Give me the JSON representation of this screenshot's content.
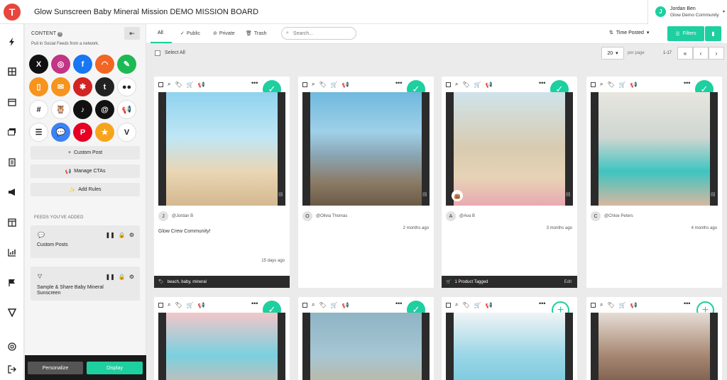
{
  "app": {
    "logo_letter": "T",
    "board_title": "Glow Sunscreen Baby Mineral Mission DEMO MISSION BOARD"
  },
  "user": {
    "initial": "J",
    "name": "Jordan Ben",
    "org": "Glow Demo Community"
  },
  "panel": {
    "heading": "CONTENT",
    "subheading": "Pull in Social Feeds from a network.",
    "networks": [
      {
        "name": "x",
        "glyph": "X",
        "color": "#111111"
      },
      {
        "name": "instagram",
        "glyph": "◎",
        "color": "#c13584"
      },
      {
        "name": "facebook",
        "glyph": "f",
        "color": "#1877f2"
      },
      {
        "name": "rss",
        "glyph": "◠",
        "color": "#f26522"
      },
      {
        "name": "custom-edit",
        "glyph": "✎",
        "color": "#1db954"
      },
      {
        "name": "mobile",
        "glyph": "▯",
        "color": "#f7941d"
      },
      {
        "name": "email",
        "glyph": "✉",
        "color": "#f7941d"
      },
      {
        "name": "yelp",
        "glyph": "✱",
        "color": "#d32323"
      },
      {
        "name": "tumblr",
        "glyph": "t",
        "color": "#222222"
      },
      {
        "name": "flickr",
        "glyph": "●●",
        "color": "#ffffff"
      },
      {
        "name": "slack",
        "glyph": "#",
        "color": "#ffffff"
      },
      {
        "name": "hootsuite",
        "glyph": "🦉",
        "color": "#ffffff"
      },
      {
        "name": "tiktok",
        "glyph": "♪",
        "color": "#111111"
      },
      {
        "name": "threads",
        "glyph": "@",
        "color": "#111111"
      },
      {
        "name": "megaphone",
        "glyph": "📢",
        "color": "#ffffff"
      },
      {
        "name": "list",
        "glyph": "☰",
        "color": "#ffffff"
      },
      {
        "name": "chat",
        "glyph": "💬",
        "color": "#3b82f6"
      },
      {
        "name": "pinterest",
        "glyph": "P",
        "color": "#e60023"
      },
      {
        "name": "star",
        "glyph": "★",
        "color": "#f7a41d"
      },
      {
        "name": "vimeo-v",
        "glyph": "V",
        "color": "#ffffff"
      }
    ],
    "buttons": {
      "custom_post": "Custom Post",
      "manage_ctas": "Manage CTAs",
      "add_rules": "Add Rules"
    },
    "feeds_heading": "FEEDS YOU'VE ADDED",
    "feeds": [
      {
        "name": "Custom Posts"
      },
      {
        "name": "Sample & Share Baby Mineral Sunscreen"
      }
    ],
    "personalize": "Personalize",
    "display": "Display"
  },
  "toolbar": {
    "tabs": [
      "All",
      "Public",
      "Private",
      "Trash"
    ],
    "search_placeholder": "Search...",
    "sort_label": "Time Posted",
    "filters_label": "Filters"
  },
  "list_controls": {
    "select_all": "Select All",
    "per_page_value": "20",
    "per_page_label": "per page",
    "range": "1-17"
  },
  "cards": [
    {
      "avatar": "J",
      "handle": "@Jordan B",
      "caption": "Glow Crew Community!",
      "time": "15 days ago",
      "footer": "beach, baby, mineral",
      "footer_edit": "",
      "status": "approved"
    },
    {
      "avatar": "O",
      "handle": "@Olivia Thomas",
      "caption": "",
      "time": "2 months ago",
      "footer": "",
      "footer_edit": "",
      "status": "approved"
    },
    {
      "avatar": "A",
      "handle": "@Ava B",
      "caption": "",
      "time": "3 months ago",
      "footer": "1 Product Tagged",
      "footer_edit": "Edit",
      "status": "approved"
    },
    {
      "avatar": "C",
      "handle": "@Chloe Peters",
      "caption": "",
      "time": "4 months ago",
      "footer": "",
      "footer_edit": "",
      "status": "approved"
    },
    {
      "status": "approved"
    },
    {
      "status": "approved"
    },
    {
      "status": "pending"
    },
    {
      "status": "pending"
    }
  ],
  "colors": {
    "accent": "#1ecf9f",
    "footer_dark": "#2b2b2b"
  }
}
